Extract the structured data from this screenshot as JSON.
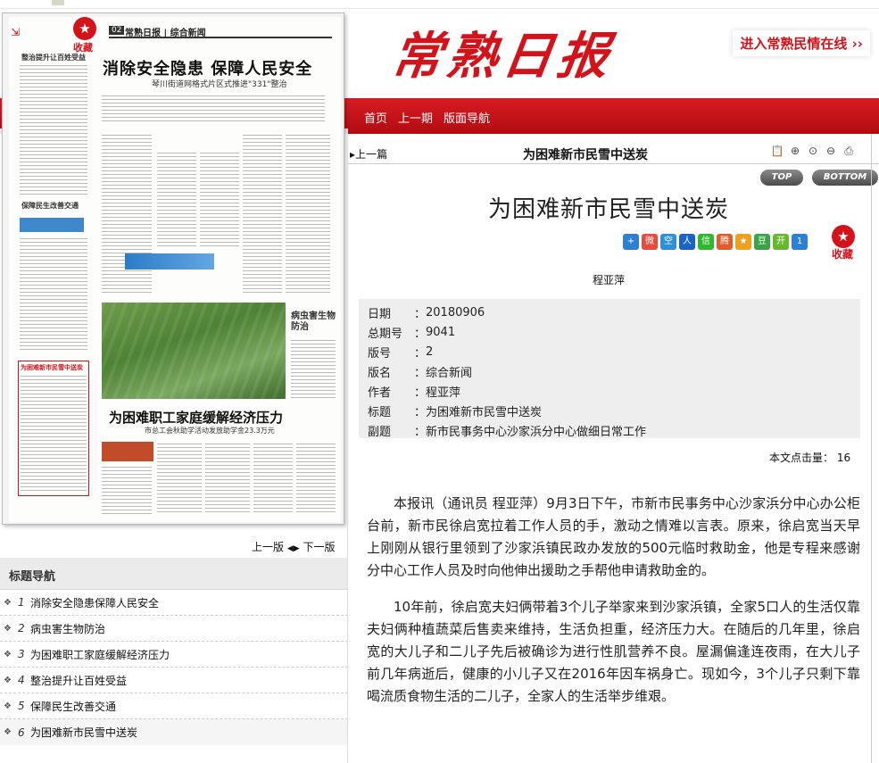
{
  "header": {
    "masthead": "常熟日报",
    "enter_link": "进入常熟民情在线 ››",
    "nav": [
      "首页",
      "上一期",
      "版面导航"
    ]
  },
  "newspaper": {
    "favorite_label": "收藏",
    "page_no": "02",
    "page_name": "常熟日报 | 综合新闻",
    "headline": "消除安全隐患 保障人民安全",
    "subhead": "琴川街道网格式片区式推进\"331\"整治",
    "pest_heading": "病虫害生物防治",
    "headline2": "为困难职工家庭缓解经济压力",
    "subhead2": "市总工会秋助学活动发放助学金23.3万元",
    "left_heads": [
      "整治提升让百姓受益",
      "保障民生改善交通",
      "为困难新市民雪中送炭"
    ]
  },
  "pager": {
    "prev": "上一版",
    "next": "下一版"
  },
  "title_nav": {
    "title": "标题导航",
    "items": [
      {
        "num": "1",
        "label": "消除安全隐患保障人民安全"
      },
      {
        "num": "2",
        "label": "病虫害生物防治"
      },
      {
        "num": "3",
        "label": "为困难职工家庭缓解经济压力"
      },
      {
        "num": "4",
        "label": "整治提升让百姓受益"
      },
      {
        "num": "5",
        "label": "保障民生改善交通"
      },
      {
        "num": "6",
        "label": "为困难新市民雪中送炭"
      }
    ]
  },
  "article": {
    "prev_link": "上一篇",
    "bar_title": "为困难新市民雪中送炭",
    "top_label": "TOP",
    "bottom_label": "BOTTOM",
    "title": "为困难新市民雪中送炭",
    "favorite_label": "收藏",
    "author": "程亚萍",
    "meta": [
      {
        "key": "日期",
        "value": "20180906"
      },
      {
        "key": "总期号",
        "value": "9041"
      },
      {
        "key": "版号",
        "value": "2"
      },
      {
        "key": "版名",
        "value": "综合新闻"
      },
      {
        "key": "作者",
        "value": "程亚萍"
      },
      {
        "key": "标题",
        "value": "为困难新市民雪中送炭"
      },
      {
        "key": "副题",
        "value": "新市民事务中心沙家浜分中心做细日常工作"
      }
    ],
    "hits_label": "本文点击量：",
    "hits_value": "16",
    "paragraphs": [
      "本报讯（通讯员 程亚萍）9月3日下午，市新市民事务中心沙家浜分中心办公柜台前，新市民徐启宽拉着工作人员的手，激动之情难以言表。原来，徐启宽当天早上刚刚从银行里领到了沙家浜镇民政办发放的500元临时救助金，他是专程来感谢分中心工作人员及时向他伸出援助之手帮他申请救助金的。",
      "10年前，徐启宽夫妇俩带着3个儿子举家来到沙家浜镇，全家5口人的生活仅靠夫妇俩种植蔬菜后售卖来维持，生活负担重，经济压力大。在随后的几年里，徐启宽的大儿子和二儿子先后被确诊为进行性肌营养不良。屋漏偏逢连夜雨，在大儿子前几年病逝后，健康的小儿子又在2016年因车祸身亡。现如今，3个儿子只剩下靠喝流质食物生活的二儿子，全家人的生活举步维艰。"
    ]
  },
  "colors": {
    "brand_red": "#d4121a",
    "meta_bg": "#eeeeee"
  }
}
